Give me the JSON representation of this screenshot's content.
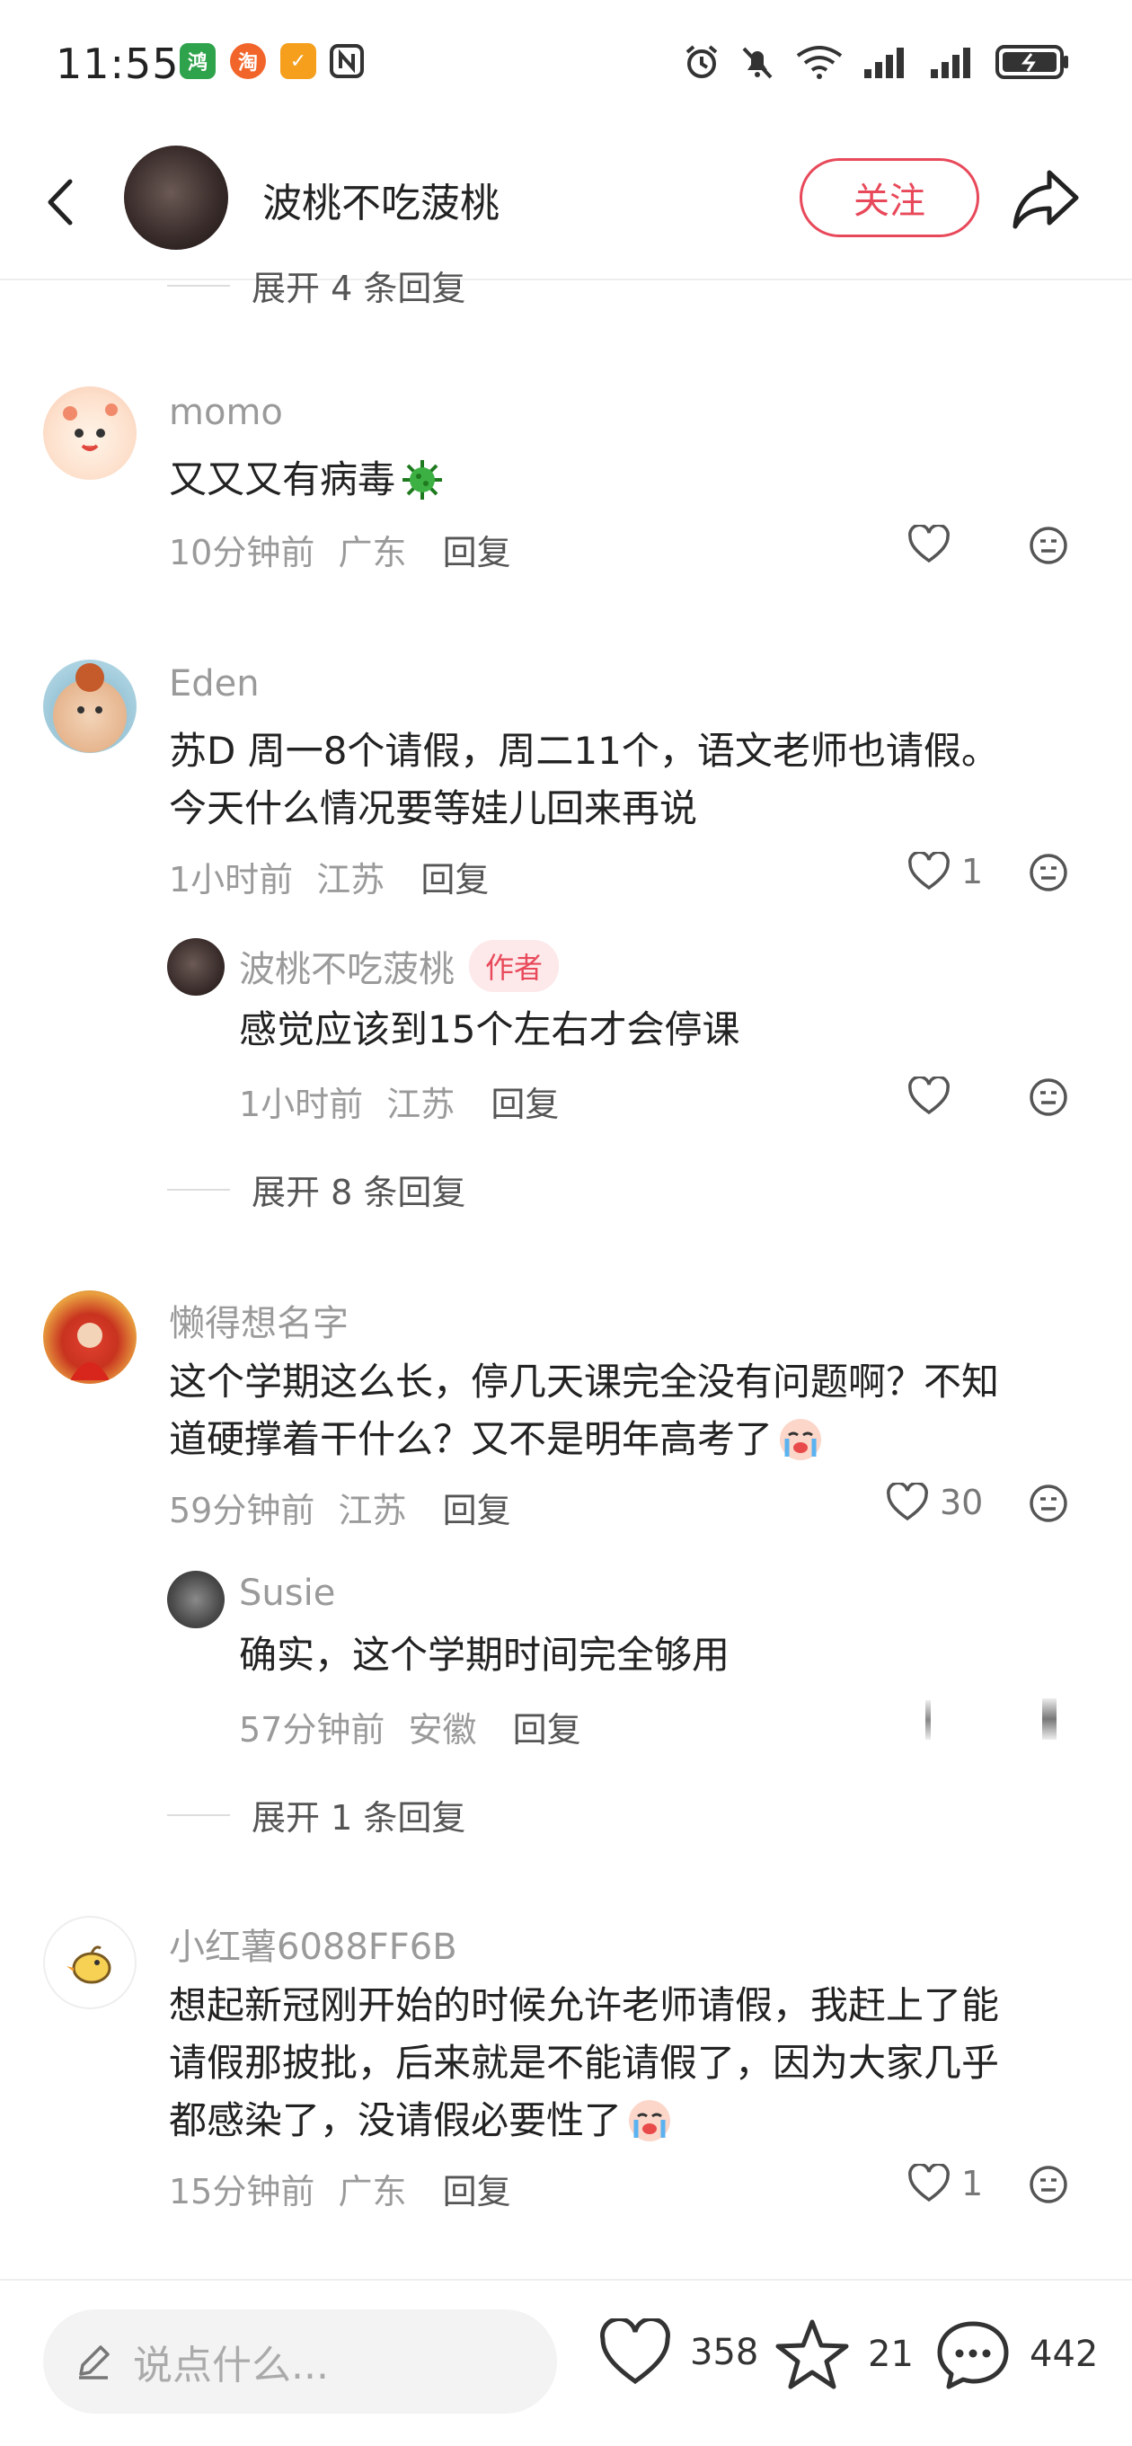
{
  "status_bar": {
    "time": "11:55",
    "app_badges": [
      {
        "text": "鸿",
        "color": "#2fa34b"
      },
      {
        "text": "淘",
        "color": "#f2652a"
      },
      {
        "text": "✓",
        "color": "#f59f1d"
      }
    ]
  },
  "header": {
    "author_name": "波桃不吃菠桃",
    "follow_label": "关注"
  },
  "top_expand": "展开 4 条回复",
  "comments": [
    {
      "name": "momo",
      "text": "又又又有病毒",
      "time": "10分钟前",
      "location": "广东",
      "reply_label": "回复",
      "likes": ""
    },
    {
      "name": "Eden",
      "text_line1": "苏D 周一8个请假，周二11个，语文老师也请假。",
      "text_line2": "今天什么情况要等娃儿回来再说",
      "time": "1小时前",
      "location": "江苏",
      "reply_label": "回复",
      "likes": "1",
      "sub": {
        "name": "波桃不吃菠桃",
        "tag": "作者",
        "text": "感觉应该到15个左右才会停课",
        "time": "1小时前",
        "location": "江苏",
        "reply_label": "回复"
      },
      "expand": "展开 8 条回复"
    },
    {
      "name": "懒得想名字",
      "text_line1": "这个学期这么长，停几天课完全没有问题啊？不知",
      "text_line2": "道硬撑着干什么？又不是明年高考了",
      "time": "59分钟前",
      "location": "江苏",
      "reply_label": "回复",
      "likes": "30",
      "sub": {
        "name": "Susie",
        "text": "确实，这个学期时间完全够用",
        "time": "57分钟前",
        "location": "安徽",
        "reply_label": "回复"
      },
      "expand": "展开 1 条回复"
    },
    {
      "name": "小红薯6088FF6B",
      "text_line1": "想起新冠刚开始的时候允许老师请假，我赶上了能",
      "text_line2": "请假那披批，后来就是不能请假了，因为大家几乎",
      "text_line3": "都感染了，没请假必要性了",
      "time": "15分钟前",
      "location": "广东",
      "reply_label": "回复",
      "likes": "1"
    }
  ],
  "bottom_bar": {
    "placeholder": "说点什么...",
    "likes": "358",
    "favorites": "21",
    "comments": "442"
  },
  "colors": {
    "accent": "#e8495a",
    "secondary_text": "#9a9a9a"
  }
}
